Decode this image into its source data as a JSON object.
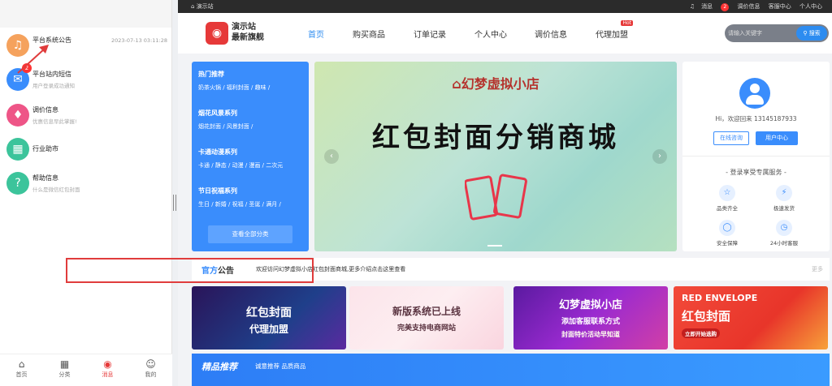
{
  "messages": [
    {
      "title": "平台系统公告",
      "subtitle": "",
      "time": "2023-07-13 03:11:28",
      "icon": "bell-icon",
      "color": "#f5a25d",
      "badge": ""
    },
    {
      "title": "平台站内短信",
      "subtitle": "用户登录成功通知",
      "time": "",
      "icon": "mail-icon",
      "color": "#3a8dfc",
      "badge": "2"
    },
    {
      "title": "调价信息",
      "subtitle": "优惠信息早此掌握!",
      "time": "",
      "icon": "price-tag-icon",
      "color": "#ee5587",
      "badge": ""
    },
    {
      "title": "行业助市",
      "subtitle": "",
      "time": "",
      "icon": "grid-icon",
      "color": "#3cc49b",
      "badge": ""
    },
    {
      "title": "帮助信息",
      "subtitle": "什么是微信红包封面",
      "time": "",
      "icon": "help-icon",
      "color": "#3cc49b",
      "badge": ""
    }
  ],
  "tabbar": [
    {
      "label": "首页",
      "icon": "home-icon",
      "active": false
    },
    {
      "label": "分类",
      "icon": "category-icon",
      "active": false
    },
    {
      "label": "消息",
      "icon": "message-icon",
      "active": true
    },
    {
      "label": "我的",
      "icon": "user-icon",
      "active": false
    }
  ],
  "topbar": {
    "home": "演示站",
    "msg": "消息",
    "msg_badge": "2",
    "links": [
      "调价信息",
      "客服中心",
      "个人中心"
    ]
  },
  "header": {
    "logo_line1": "演示站",
    "logo_line2": "最新旗舰",
    "nav": [
      {
        "label": "首页",
        "active": true
      },
      {
        "label": "购买商品",
        "active": false
      },
      {
        "label": "订单记录",
        "active": false
      },
      {
        "label": "个人中心",
        "active": false
      },
      {
        "label": "调价信息",
        "active": false
      },
      {
        "label": "代理加盟",
        "active": false,
        "tag": "Hot"
      }
    ],
    "search_placeholder": "请输入关键字",
    "search_button": "搜索"
  },
  "categories": [
    {
      "title": "热门推荐",
      "links": "奶茶火锅 / 福利封面 / 趣味 /"
    },
    {
      "title": "烟花风景系列",
      "links": "烟花封面 / 风景封面 /"
    },
    {
      "title": "卡通动漫系列",
      "links": "卡通 / 静态 / 动漫 / 漫画 / 二次元"
    },
    {
      "title": "节日祝福系列",
      "links": "生日 / 新婚 / 祝福 / 圣诞 / 满月 /"
    }
  ],
  "all_categories": "查看全部分类",
  "banner": {
    "subtitle": "幻梦虚拟小店",
    "title": "红包封面分销商城"
  },
  "user": {
    "welcome": "Hi，欢迎回来 13145187933",
    "btn_service": "在线咨询",
    "btn_center": "用户中心",
    "services_title": "- 登录享受专属服务 -",
    "services": [
      {
        "label": "品类齐全",
        "icon": "basket-icon"
      },
      {
        "label": "极速发货",
        "icon": "lightning-icon"
      },
      {
        "label": "安全保障",
        "icon": "shield-icon"
      },
      {
        "label": "24小时客服",
        "icon": "clock-24-icon"
      }
    ]
  },
  "notice": {
    "title_a": "官方",
    "title_b": "公告",
    "text": "欢迎访问幻梦虚拟小店红包封面商城,更多介绍点击这里查看",
    "more": "更多"
  },
  "promos": [
    {
      "line1": "红包封面",
      "line2": "代理加盟"
    },
    {
      "line1": "新版系统已上线",
      "line2": "完美支持电商网站"
    },
    {
      "line1": "幻梦虚拟小店",
      "line2": "添加客服联系方式",
      "line3": "封面特价活动早知道"
    },
    {
      "line1": "RED ENVELOPE",
      "line2": "红包封面",
      "line3": "立即开始选购"
    }
  ],
  "featured": {
    "title": "精品推荐",
    "subtitle": "诚意推荐 品质商品"
  },
  "colors": {
    "accent": "#3a8dfc",
    "brand_red": "#e63939",
    "highlight_box": "#e03c3c"
  }
}
